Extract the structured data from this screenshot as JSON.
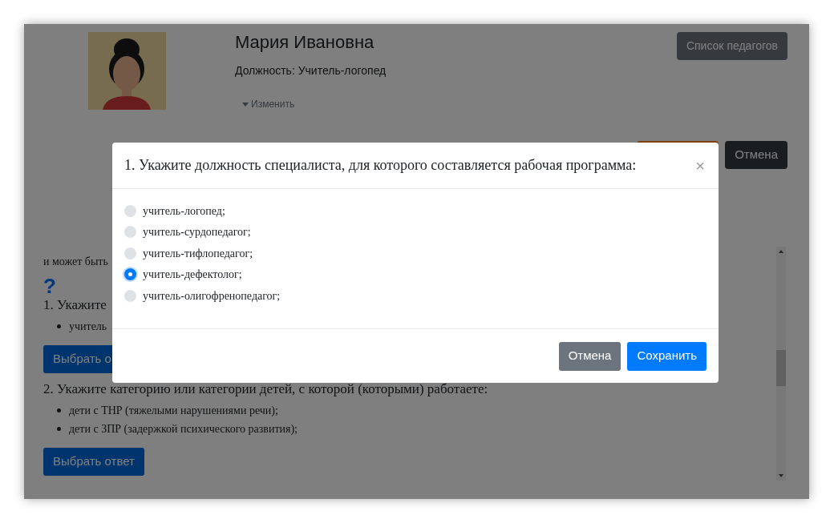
{
  "profile": {
    "name": "Мария Ивановна",
    "position": "Должность: Учитель-логопед",
    "change_link": "Изменить"
  },
  "header_buttons": {
    "teachers_list": "Список педагогов",
    "cancel": "Отмена"
  },
  "content": {
    "fragment": "и может быть",
    "help_mark": "?",
    "questions": [
      {
        "title": "1. Укажите",
        "items": [
          "учитель"
        ],
        "button": "Выбрать о"
      },
      {
        "title": "2. Укажите категорию или категории детей, с которой (которыми) работаете:",
        "items": [
          "дети с ТНР (тяжелыми нарушениями речи);",
          "дети с ЗПР (задержкой психического развития);"
        ],
        "button": "Выбрать ответ"
      }
    ]
  },
  "modal": {
    "title": "1. Укажите должность специалиста, для которого составляется рабочая программа:",
    "close": "×",
    "options": [
      {
        "label": "учитель-логопед;",
        "selected": false
      },
      {
        "label": "учитель-сурдопедагог;",
        "selected": false
      },
      {
        "label": "учитель-тифлопедагог;",
        "selected": false
      },
      {
        "label": "учитель-дефектолог;",
        "selected": true
      },
      {
        "label": "учитель-олигофренопедагог;",
        "selected": false
      }
    ],
    "cancel": "Отмена",
    "save": "Сохранить"
  }
}
